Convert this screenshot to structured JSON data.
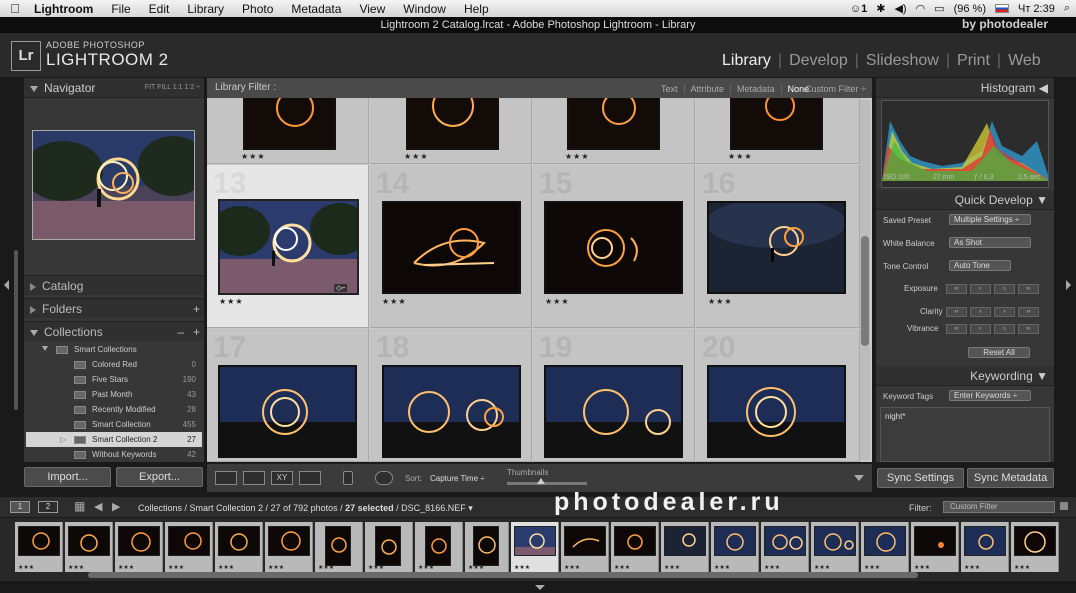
{
  "menubar": {
    "apple": "",
    "app_name": "Lightroom",
    "items": [
      "File",
      "Edit",
      "Library",
      "Photo",
      "Metadata",
      "View",
      "Window",
      "Help"
    ],
    "status_battery": "(96 %)",
    "status_clock": "Чт 2:39",
    "status_badge": "1",
    "icon_names": [
      "notification-icon",
      "bluetooth-icon",
      "volume-icon",
      "wifi-icon",
      "battery-icon",
      "flag-icon",
      "spotlight-icon"
    ]
  },
  "window": {
    "title": "Lightroom 2 Catalog.lrcat - Adobe Photoshop Lightroom - Library",
    "watermark_top": "by photodealer"
  },
  "header": {
    "logo_box": "Lr",
    "logo_small": "ADOBE PHOTOSHOP",
    "logo_big": "LIGHTROOM 2",
    "modules": [
      "Library",
      "Develop",
      "Slideshow",
      "Print",
      "Web"
    ],
    "active_module": "Library"
  },
  "left_panel": {
    "navigator": {
      "title": "Navigator",
      "zoom": "FIT   FILL   1:1   1:2 ÷"
    },
    "catalog": "Catalog",
    "folders": "Folders",
    "collections": "Collections",
    "collections_actions": [
      "–",
      "+"
    ],
    "tree": [
      {
        "label": "Smart Collections",
        "count": ""
      },
      {
        "label": "Colored Red",
        "count": "0"
      },
      {
        "label": "Five Stars",
        "count": "190"
      },
      {
        "label": "Past Month",
        "count": "43"
      },
      {
        "label": "Recently Modified",
        "count": "28"
      },
      {
        "label": "Smart Collection",
        "count": "455"
      },
      {
        "label": "Smart Collection 2",
        "count": "27"
      },
      {
        "label": "Without Keywords",
        "count": "42"
      }
    ],
    "import_label": "Import...",
    "export_label": "Export..."
  },
  "filter_bar": {
    "label": "Library Filter :",
    "options": [
      "Text",
      "Attribute",
      "Metadata",
      "None"
    ],
    "active": "None",
    "custom": "Custom Filter ÷"
  },
  "grid": {
    "top_row_stars": [
      "★★★",
      "★★★",
      "★★★",
      "★★★"
    ],
    "cells": [
      {
        "num": "13",
        "stars": "★★★",
        "selected": true
      },
      {
        "num": "14",
        "stars": "★★★",
        "selected": false
      },
      {
        "num": "15",
        "stars": "★★★",
        "selected": false
      },
      {
        "num": "16",
        "stars": "★★★",
        "selected": false
      },
      {
        "num": "17",
        "stars": "",
        "selected": false
      },
      {
        "num": "18",
        "stars": "",
        "selected": false
      },
      {
        "num": "19",
        "stars": "",
        "selected": false
      },
      {
        "num": "20",
        "stars": "",
        "selected": false
      }
    ]
  },
  "toolbar": {
    "sort_label": "Sort:",
    "sort_value": "Capture Time ÷",
    "thumbnails_label": "Thumbnails"
  },
  "right_panel": {
    "histogram_title": "Histogram",
    "iso": "ISO 100",
    "focal": "27 mm",
    "aperture": "ƒ / 6,3",
    "shutter": "2,5 sec",
    "quick_develop": "Quick Develop",
    "saved_preset": "Saved Preset",
    "saved_preset_value": "Multiple Settings ÷",
    "white_balance": "White Balance",
    "white_balance_value": "As Shot",
    "tone_control": "Tone Control",
    "auto_tone": "Auto Tone",
    "exposure": "Exposure",
    "clarity": "Clarity",
    "vibrance": "Vibrance",
    "steppers": [
      "‹‹",
      "‹",
      "›",
      "››"
    ],
    "reset_all": "Reset All",
    "keywording": "Keywording",
    "keyword_tags": "Keyword Tags",
    "keyword_tags_value": "Enter Keywords ÷",
    "keyword_text": "night*",
    "sync_settings": "Sync Settings",
    "sync_metadata": "Sync Metadata"
  },
  "filmstrip_bar": {
    "page1": "1",
    "page2": "2",
    "crumb_path": "Collections / Smart Collection 2 / 27 of 792 photos / ",
    "crumb_selected": "27 selected",
    "crumb_file": " / DSC_8166.NEF ▾",
    "filter_label": "Filter:",
    "filter_value": "Custom Filter"
  },
  "watermark": "photodealer.ru",
  "colors": {
    "accent_active_module": "#eeeeee",
    "panel_bg": "#373737",
    "grid_bg": "#c9c9c9"
  }
}
